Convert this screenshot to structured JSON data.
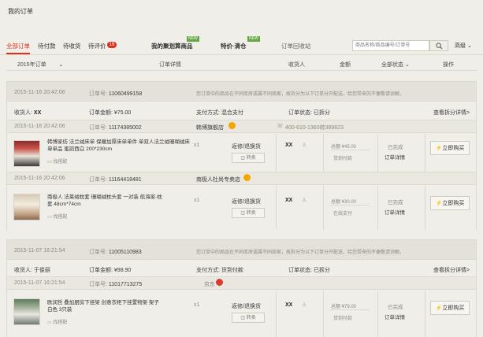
{
  "page_title": "我的订单",
  "tabs": [
    {
      "label": "全部订单"
    },
    {
      "label": "待付款"
    },
    {
      "label": "待收货"
    },
    {
      "label": "待评价",
      "badge": "19"
    },
    {
      "label": "我的聚划算商品",
      "new": "NEW"
    },
    {
      "label": "特价·清仓",
      "new": "NEW"
    },
    {
      "label": "订单回收站"
    }
  ],
  "search": {
    "placeholder": "商品名称/商品编号/订单号",
    "advanced": "高级"
  },
  "table_header": {
    "year": "2015年订单",
    "detail": "订单详情",
    "receiver": "收货人",
    "amount": "金额",
    "status": "全部状态",
    "action": "操作"
  },
  "orders": [
    {
      "time": "2015-11-16 20:42:06",
      "order_no_label": "订单号:",
      "order_no": "11060499158",
      "split_notice": "您订单中的商品在不同库房或属不同商家，故拆分为以下订单分开配送，给您带来的不便敬请谅解。",
      "receiver_label": "收货人:",
      "receiver": "XX",
      "amount_label": "订单金额:",
      "amount": "¥75.00",
      "pay_label": "支付方式:",
      "pay": "混合支付",
      "status_label": "订单状态:",
      "status": "已拆分",
      "view_split": "查看拆分详情>",
      "sub_orders": [
        {
          "time": "2015-11-16 20:42:06",
          "order_no_label": "订单号:",
          "order_no": "11174385002",
          "shop": "韩博旗舰店",
          "phone": "400-610-1360转389823",
          "item_title": "韩博家纺 法兰绒床单 保暖加厚床单单件 单双人法兰绒珊瑚绒床单单品 蜜韵西白 200*230cm",
          "collocation": "找搭配",
          "qty": "x1",
          "service": "返修/退换货",
          "sale": "转卖",
          "receiver": "XX",
          "price": "总额 ¥45.00",
          "pay_type": "货到付款",
          "state": "已完成",
          "detail": "订单详情",
          "buy": "立即购买"
        },
        {
          "time": "2015-11-16 20:42:06",
          "order_no_label": "订单号:",
          "order_no": "11164418481",
          "shop": "南极人杜尚专卖店",
          "phone": "",
          "item_title": "南极人 法莱绒枕套 珊瑚绒枕头套 一对装 航海家-枕套 48cm*74cm",
          "collocation": "找搭配",
          "qty": "x1",
          "service": "返修/退换货",
          "sale": "转卖",
          "receiver": "XX",
          "price": "总额 ¥30.00",
          "pay_type": "在线支付",
          "state": "已完成",
          "detail": "订单详情",
          "buy": "立即购买"
        }
      ]
    },
    {
      "time": "2015-11-07 16:21:54",
      "order_no_label": "订单号:",
      "order_no": "11005110983",
      "split_notice": "您订单中的商品在不同库房或属不同商家，故拆分为以下订单分开配送，给您带来的不便敬请谅解。",
      "receiver_label": "收货人:",
      "receiver": "于俊丽",
      "amount_label": "订单金额:",
      "amount": "¥98.90",
      "pay_label": "支付方式:",
      "pay": "货到付款",
      "status_label": "订单状态:",
      "status": "已拆分",
      "view_split": "查看拆分详情>",
      "sub_orders": [
        {
          "time": "2015-11-07 16:21:54",
          "order_no_label": "订单号:",
          "order_no": "11017713275",
          "shop": "京东",
          "phone": "",
          "item_title": "欧润哲 叠加厨房下挂架 创意衣柜下挂置物架 架子 白色 3只装",
          "collocation": "找搭配",
          "qty": "x1",
          "service": "返修/退换货",
          "sale": "转卖",
          "receiver": "XX",
          "price": "总额 ¥79.00",
          "pay_type": "货到付款",
          "state": "已完成",
          "detail": "订单详情",
          "buy": "立即购买"
        }
      ]
    }
  ],
  "colors": {
    "accent": "#e0311b",
    "new_tag": "#65a741",
    "background": "#efeee8"
  }
}
